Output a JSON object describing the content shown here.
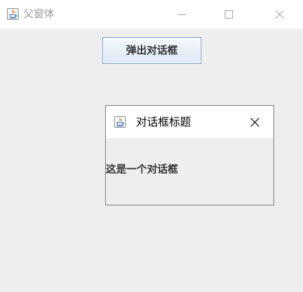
{
  "main_window": {
    "title": "父窗体",
    "icon": "java-icon",
    "controls": [
      "minimize-icon",
      "maximize-icon",
      "close-icon"
    ]
  },
  "popup_button": {
    "label": "弹出对话框"
  },
  "dialog": {
    "title": "对话框标题",
    "icon": "java-icon",
    "message": "这是一个对话框",
    "close_icon": "close-icon"
  },
  "colors": {
    "background": "#eeeeee",
    "titlebar": "#ffffff",
    "button_border": "#7a9cc2",
    "dialog_border": "#7a7a7a",
    "java_red": "#e8722a",
    "java_blue": "#4a78b3"
  }
}
